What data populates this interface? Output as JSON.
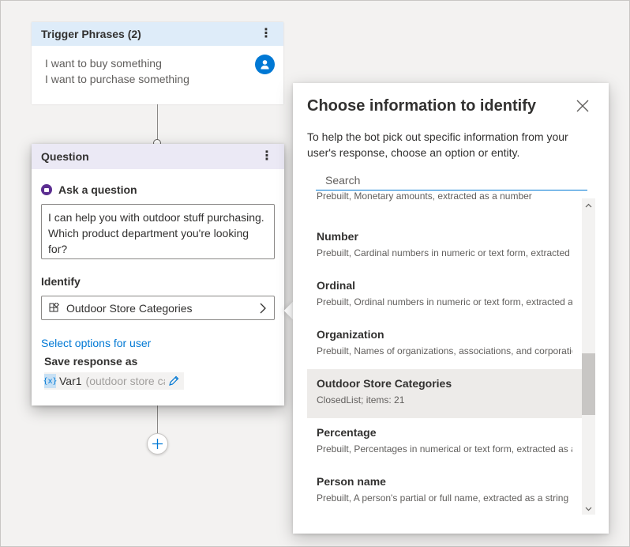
{
  "trigger": {
    "title": "Trigger Phrases (2)",
    "phrases": [
      "I want to buy something",
      "I want to purchase something"
    ],
    "menu_glyph": "⋮"
  },
  "question": {
    "title": "Question",
    "menu_glyph": "⋮",
    "ask_label": "Ask a question",
    "message": "I can help you with outdoor stuff purchasing. Which product department you're looking for?",
    "identify_label": "Identify",
    "entity_value": "Outdoor Store Categories",
    "select_options_link": "Select options for user",
    "save_label": "Save response as",
    "var_badge": "{x}",
    "var_name": "Var1",
    "var_hint": "(outdoor store categories)"
  },
  "panel": {
    "title": "Choose information to identify",
    "description": "To help the bot pick out specific information from your user's response, choose an option or entity.",
    "search_placeholder": "Search",
    "partial_item_desc": "Prebuilt, Monetary amounts, extracted as a number",
    "items": [
      {
        "title": "Number",
        "desc": "Prebuilt, Cardinal numbers in numeric or text form, extracted as a number"
      },
      {
        "title": "Ordinal",
        "desc": "Prebuilt, Ordinal numbers in numeric or text form, extracted as a number"
      },
      {
        "title": "Organization",
        "desc": "Prebuilt, Names of organizations, associations, and corporations"
      },
      {
        "title": "Outdoor Store Categories",
        "desc": "ClosedList; items: 21",
        "selected": true
      },
      {
        "title": "Percentage",
        "desc": "Prebuilt, Percentages in numerical or text form, extracted as a number"
      },
      {
        "title": "Person name",
        "desc": "Prebuilt, A person's partial or full name, extracted as a string"
      }
    ],
    "scroll_fraction": 0.2
  },
  "colors": {
    "accent": "#0078d4",
    "trigger_header": "#deecf9",
    "question_header": "#ebe9f5",
    "selected_item": "#edebe9"
  }
}
